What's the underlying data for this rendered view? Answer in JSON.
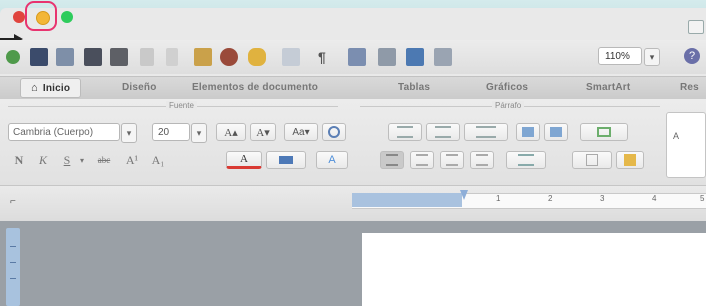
{
  "window": {
    "traffic_lights": {
      "close": "close-button",
      "minimize": "minimize-button",
      "zoom": "zoom-button"
    },
    "highlight_color": "#e8336f"
  },
  "toolbar": {
    "zoom_value": "110%",
    "zoom_arrow": "▾",
    "help_symbol": "?"
  },
  "ribbon_tabs": [
    {
      "label": "Inicio",
      "active": true
    },
    {
      "label": "Diseño"
    },
    {
      "label": "Elementos de documento"
    },
    {
      "label": "Tablas"
    },
    {
      "label": "Gráficos"
    },
    {
      "label": "SmartArt"
    },
    {
      "label": "Res"
    }
  ],
  "home_glyph": "⌂",
  "groups": {
    "font": "Fuente",
    "paragraph": "Párrafo"
  },
  "font": {
    "name": "Cambria (Cuerpo)",
    "size": "20",
    "arrow": "▾",
    "grow": "A▴",
    "shrink": "A▾",
    "change_case": "Aa▾",
    "bold": "N",
    "italic": "K",
    "underline": "S",
    "strikethrough": "abc",
    "superscript": "A¹",
    "subscript": "A₁",
    "font_color": "A",
    "highlight": "A"
  },
  "styles_preview": "A"
}
